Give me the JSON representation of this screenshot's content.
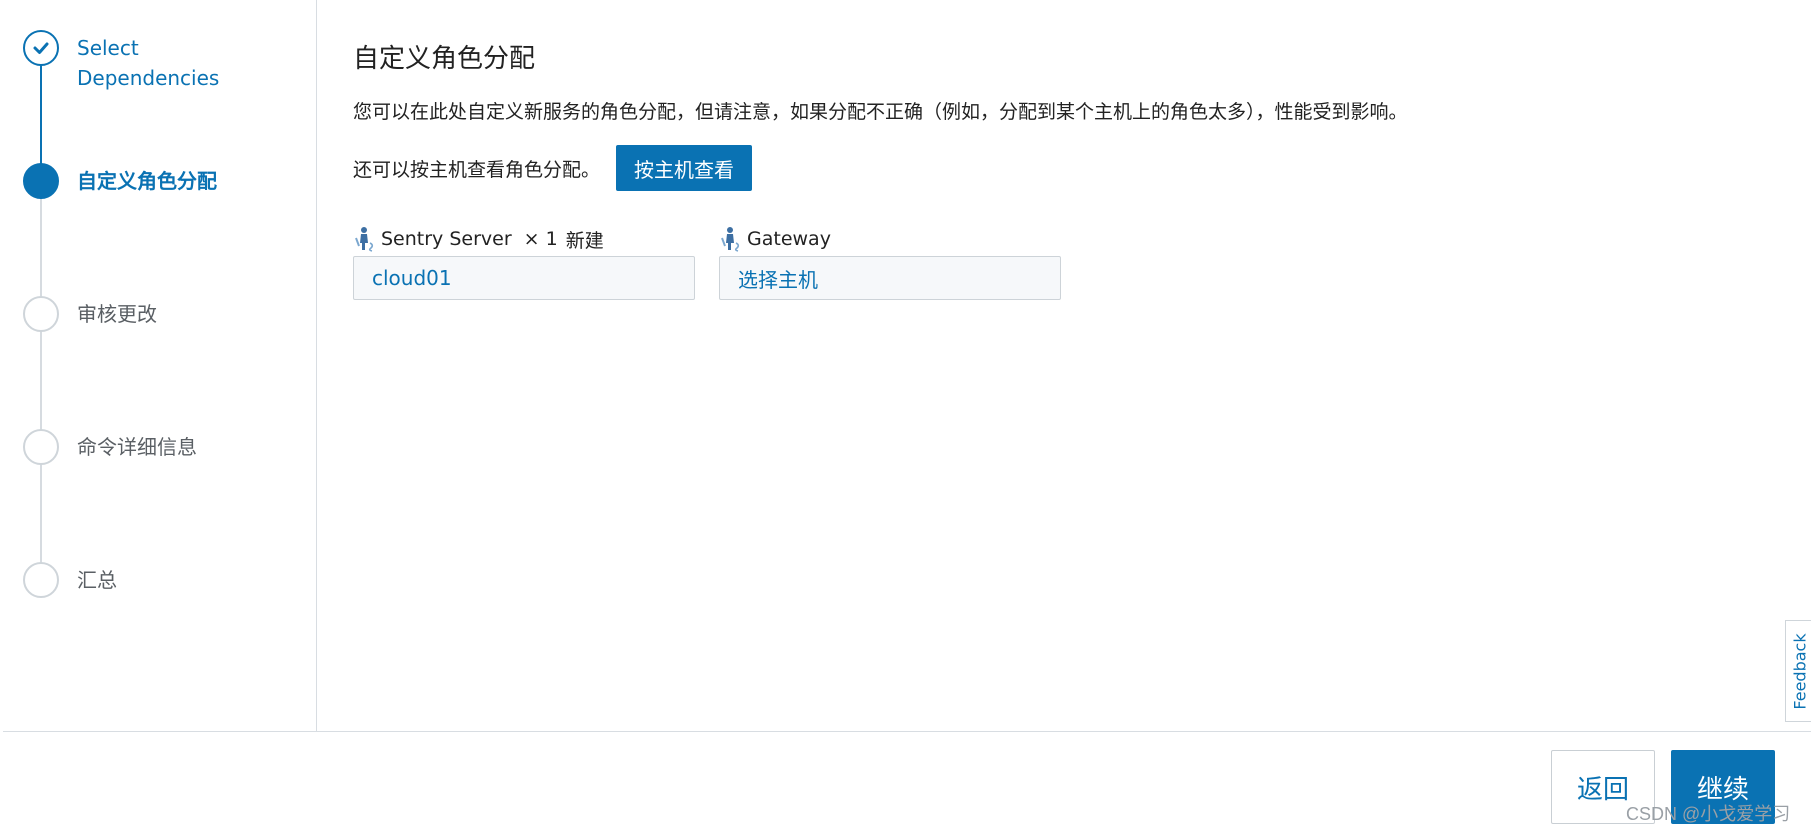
{
  "wizard": {
    "steps": [
      {
        "label": "Select Dependencies",
        "state": "done"
      },
      {
        "label": "自定义角色分配",
        "state": "current"
      },
      {
        "label": "审核更改",
        "state": "pending"
      },
      {
        "label": "命令详细信息",
        "state": "pending"
      },
      {
        "label": "汇总",
        "state": "pending"
      }
    ]
  },
  "main": {
    "title": "自定义角色分配",
    "description": "您可以在此处自定义新服务的角色分配，但请注意，如果分配不正确（例如，分配到某个主机上的角色太多），性能受到影响。",
    "host_view_text": "还可以按主机查看角色分配。",
    "host_view_button": "按主机查看",
    "roles": [
      {
        "name": "Sentry Server",
        "count": "× 1",
        "badge": "新建",
        "value": "cloud01",
        "icon": "role-person-icon"
      },
      {
        "name": "Gateway",
        "value": "选择主机",
        "icon": "role-person-icon"
      }
    ]
  },
  "footer": {
    "back_label": "返回",
    "next_label": "继续"
  },
  "feedback_label": "Feedback",
  "watermark": "CSDN @小戈爱学习",
  "colors": {
    "accent": "#0a72b3",
    "border": "#cdd3d8",
    "input_bg": "#f6f8fa"
  }
}
